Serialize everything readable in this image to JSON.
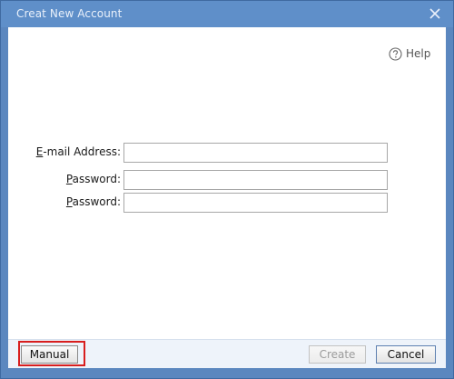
{
  "window": {
    "title": "Creat New Account"
  },
  "help": {
    "label": "Help",
    "icon": "help-circle-icon"
  },
  "form": {
    "email": {
      "label_accel": "E",
      "label_rest": "-mail Address:",
      "value": ""
    },
    "password": {
      "label_accel": "P",
      "label_rest": "assword:",
      "value": ""
    },
    "password_confirm": {
      "label_accel": "P",
      "label_rest": "assword:",
      "value": ""
    }
  },
  "footer": {
    "manual_label": "Manual",
    "create_label": "Create",
    "cancel_label": "Cancel"
  },
  "colors": {
    "titlebar": "#5f8fc9",
    "highlight": "#d81e1e"
  }
}
